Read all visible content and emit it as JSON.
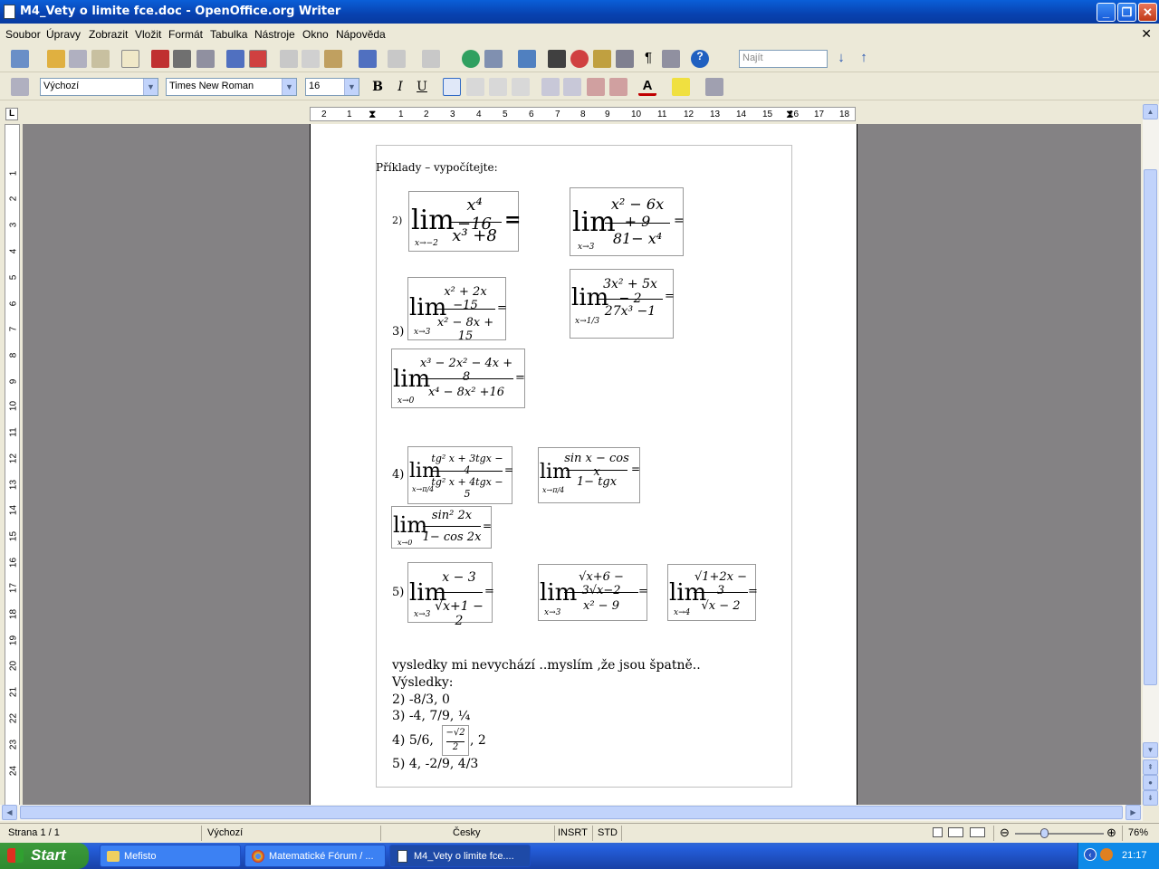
{
  "window": {
    "title": "M4_Vety o limite fce.doc - OpenOffice.org Writer"
  },
  "menu": [
    "Soubor",
    "Úpravy",
    "Zobrazit",
    "Vložit",
    "Formát",
    "Tabulka",
    "Nástroje",
    "Okno",
    "Nápověda"
  ],
  "toolbar": {
    "find_placeholder": "Najít"
  },
  "format": {
    "style": "Výchozí",
    "font": "Times New Roman",
    "size": "16",
    "bold": "B",
    "italic": "I",
    "underline": "U"
  },
  "ruler": {
    "h_ticks": [
      "2",
      "1",
      "1",
      "2",
      "3",
      "4",
      "5",
      "6",
      "7",
      "8",
      "9",
      "10",
      "11",
      "12",
      "13",
      "14",
      "15",
      "16",
      "17",
      "18"
    ],
    "v_ticks": [
      "1",
      "2",
      "3",
      "4",
      "5",
      "6",
      "7",
      "8",
      "9",
      "10",
      "11",
      "12",
      "13",
      "14",
      "15",
      "16",
      "17",
      "18",
      "19",
      "20",
      "21",
      "22",
      "23",
      "24"
    ]
  },
  "document": {
    "heading": "Příklady – vypočítejte:",
    "labels": {
      "l2": "2)",
      "l3": "3)",
      "l4": "4)",
      "l5": "5)"
    },
    "formulas": {
      "f2a": {
        "lim": "lim",
        "sub": "x→−2",
        "num": "x⁴ −16",
        "den": "x³ +8",
        "eq": "="
      },
      "f2b": {
        "lim": "lim",
        "sub": "x→3",
        "num": "x² − 6x + 9",
        "den": "81− x⁴",
        "eq": "="
      },
      "f3a": {
        "lim": "lim",
        "sub": "x→3",
        "num": "x² + 2x −15",
        "den": "x² − 8x + 15",
        "eq": "="
      },
      "f3b": {
        "lim": "lim",
        "sub": "x→1/3",
        "num": "3x² + 5x − 2",
        "den": "27x³ −1",
        "eq": "="
      },
      "f3c": {
        "lim": "lim",
        "sub": "x→0",
        "num": "x³ − 2x² − 4x + 8",
        "den": "x⁴ − 8x² +16",
        "eq": "="
      },
      "f4a": {
        "lim": "lim",
        "sub": "x→π/4",
        "num": "tg² x + 3tgx − 4",
        "den": "tg² x + 4tgx − 5",
        "eq": "="
      },
      "f4b": {
        "lim": "lim",
        "sub": "x→π/4",
        "num": "sin x − cos x",
        "den": "1− tgx",
        "eq": "="
      },
      "f4c": {
        "lim": "lim",
        "sub": "x→0",
        "num": "sin² 2x",
        "den": "1− cos 2x",
        "eq": "="
      },
      "f5a": {
        "lim": "lim",
        "sub": "x→3",
        "num": "x − 3",
        "den": "√x+1 − 2",
        "eq": "="
      },
      "f5b": {
        "lim": "lim",
        "sub": "x→3",
        "num": "√x+6 − 3√x−2",
        "den": "x² − 9",
        "eq": "="
      },
      "f5c": {
        "lim": "lim",
        "sub": "x→4",
        "num": "√1+2x − 3",
        "den": "√x − 2",
        "eq": "="
      }
    },
    "comment": "vysledky mi nevychází ..myslím ,že jsou špatně..",
    "results_title": "Výsledky:",
    "results": {
      "r2": "2)   -8/3,   0",
      "r3": "3) -4,   7/9,   ¼",
      "r4a": "4) 5/6,",
      "r4frac_num": "−√2",
      "r4frac_den": "2",
      "r4b": ",   2",
      "r5": "5) 4,   -2/9,   4/3"
    }
  },
  "status": {
    "page": "Strana 1 / 1",
    "style": "Výchozí",
    "lang": "Česky",
    "insrt": "INSRT",
    "std": "STD",
    "zoom": "76%"
  },
  "taskbar": {
    "start": "Start",
    "tasks": [
      "Mefisto",
      "Matematické Fórum / ...",
      "M4_Vety o limite fce...."
    ],
    "clock": "21:17"
  },
  "colors": {
    "titlebar": "#0842b0",
    "page_bg": "#848284",
    "taskbar": "#245edb"
  }
}
